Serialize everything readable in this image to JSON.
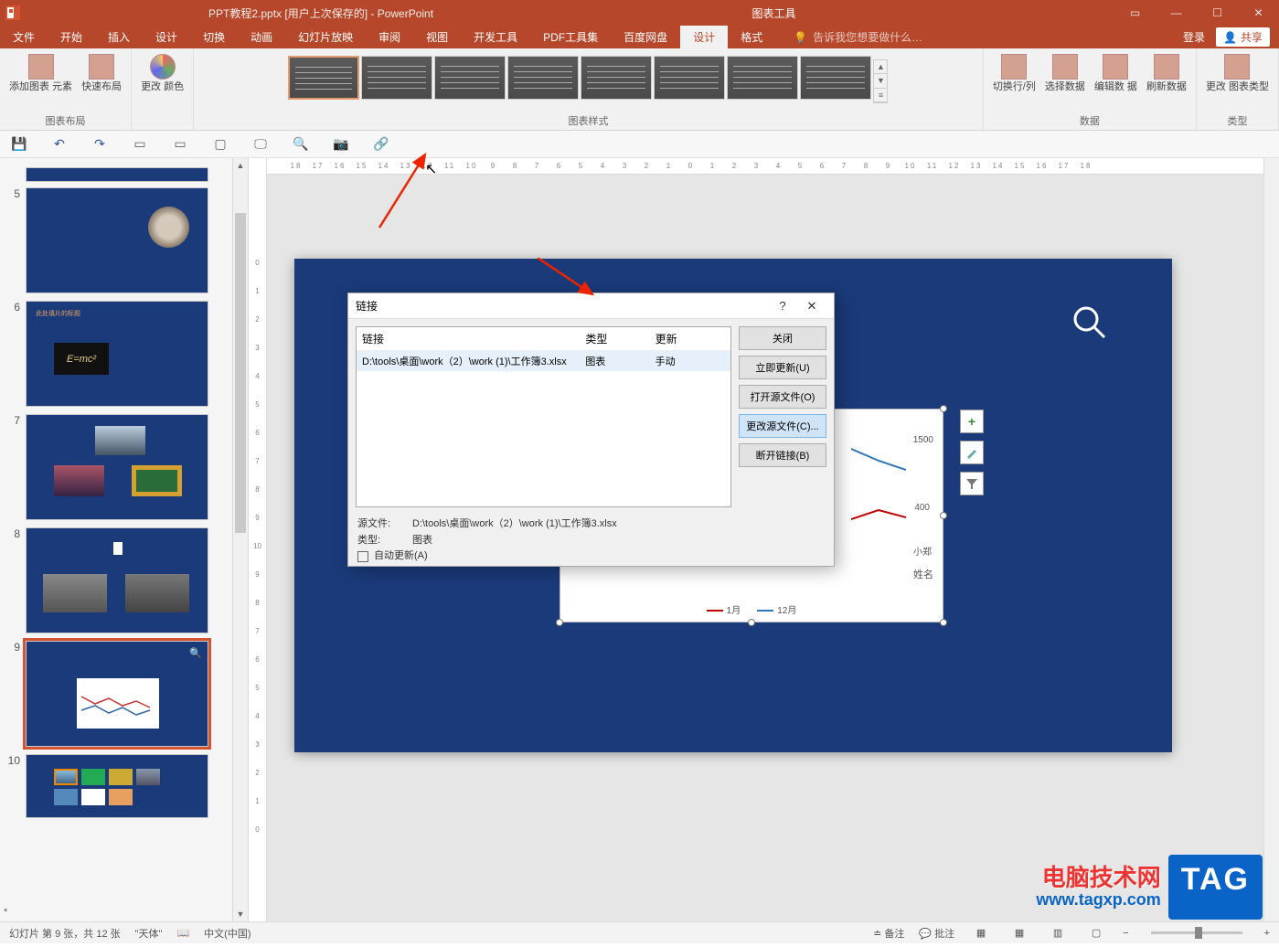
{
  "titlebar": {
    "document_title": "PPT教程2.pptx [用户上次保存的] - PowerPoint",
    "tool_context": "图表工具",
    "login": "登录",
    "share": "共享"
  },
  "tabs": {
    "items": [
      "文件",
      "开始",
      "插入",
      "设计",
      "切换",
      "动画",
      "幻灯片放映",
      "审阅",
      "视图",
      "开发工具",
      "PDF工具集",
      "百度网盘"
    ],
    "context_tabs": [
      "设计",
      "格式"
    ],
    "tell_me": "告诉我您想要做什么…"
  },
  "ribbon": {
    "group1": {
      "btn1": "添加图表\n元素",
      "btn2": "快速布局",
      "label": "图表布局"
    },
    "group2": {
      "btn1": "更改\n颜色"
    },
    "group3_label": "图表样式",
    "group4": {
      "b1": "切换行/列",
      "b2": "选择数据",
      "b3": "编辑数\n据",
      "b4": "刷新数据",
      "label": "数据"
    },
    "group5": {
      "b1": "更改\n图表类型",
      "label": "类型"
    }
  },
  "ruler_h": [
    "18",
    "17",
    "16",
    "15",
    "14",
    "13",
    "12",
    "11",
    "10",
    "9",
    "8",
    "7",
    "6",
    "5",
    "4",
    "3",
    "2",
    "1",
    "0",
    "1",
    "2",
    "3",
    "4",
    "5",
    "6",
    "7",
    "8",
    "9",
    "10",
    "11",
    "12",
    "13",
    "14",
    "15",
    "16",
    "17",
    "18"
  ],
  "ruler_v": [
    "0",
    "1",
    "2",
    "3",
    "4",
    "5",
    "6",
    "7",
    "8",
    "9",
    "10",
    "9",
    "8",
    "7",
    "6",
    "5",
    "4",
    "3",
    "2",
    "1",
    "0"
  ],
  "slides": {
    "numbers": [
      "5",
      "6",
      "7",
      "8",
      "9",
      "10"
    ],
    "s6_label": "此处填片的标题",
    "star_note": "*"
  },
  "dialog": {
    "title": "链接",
    "columns": {
      "c1": "链接",
      "c2": "类型",
      "c3": "更新"
    },
    "row": {
      "path": "D:\\tools\\桌面\\work（2）\\work (1)\\工作簿3.xlsx",
      "type": "图表",
      "update": "手动"
    },
    "buttons": {
      "close": "关闭",
      "update_now": "立即更新(U)",
      "open_src": "打开源文件(O)",
      "change_src": "更改源文件(C)...",
      "break": "断开链接(B)"
    },
    "info": {
      "src_label": "源文件:",
      "src_val": "D:\\tools\\桌面\\work（2）\\work (1)\\工作簿3.xlsx",
      "type_label": "类型:",
      "type_val": "图表",
      "auto_update": "自动更新(A)"
    }
  },
  "chart_area": {
    "tick_1500": "1500",
    "tick_400": "400",
    "x_label_right": "小郑",
    "axis_label": "姓名",
    "legend_1": "1月",
    "legend_12": "12月",
    "side_tools": {
      "plus": "+",
      "brush": "",
      "filter": ""
    }
  },
  "statusbar": {
    "slide_pos": "幻灯片 第 9 张，共 12 张",
    "theme": "\"天体\"",
    "lang": "中文(中国)",
    "notes": "备注",
    "comments": "批注",
    "zoom_minus": "−",
    "zoom_plus": "+"
  },
  "watermark": {
    "name": "电脑技术网",
    "url": "www.tagxp.com",
    "tag": "TAG"
  },
  "chart_data": {
    "type": "line",
    "title": "",
    "xlabel": "姓名",
    "ylabel": "",
    "ylim": [
      0,
      1600
    ],
    "categories": [
      "小郑"
    ],
    "series": [
      {
        "name": "1月",
        "color": "#C00000",
        "values": [
          400
        ]
      },
      {
        "name": "12月",
        "color": "#2E75B6",
        "values": [
          1500
        ]
      }
    ],
    "notes": "Most of the chart is occluded by the Links dialog; only right-edge data labels 1500 and 400, the category 小郑, axis label 姓名, and legend entries 1月 / 12月 are visible."
  }
}
